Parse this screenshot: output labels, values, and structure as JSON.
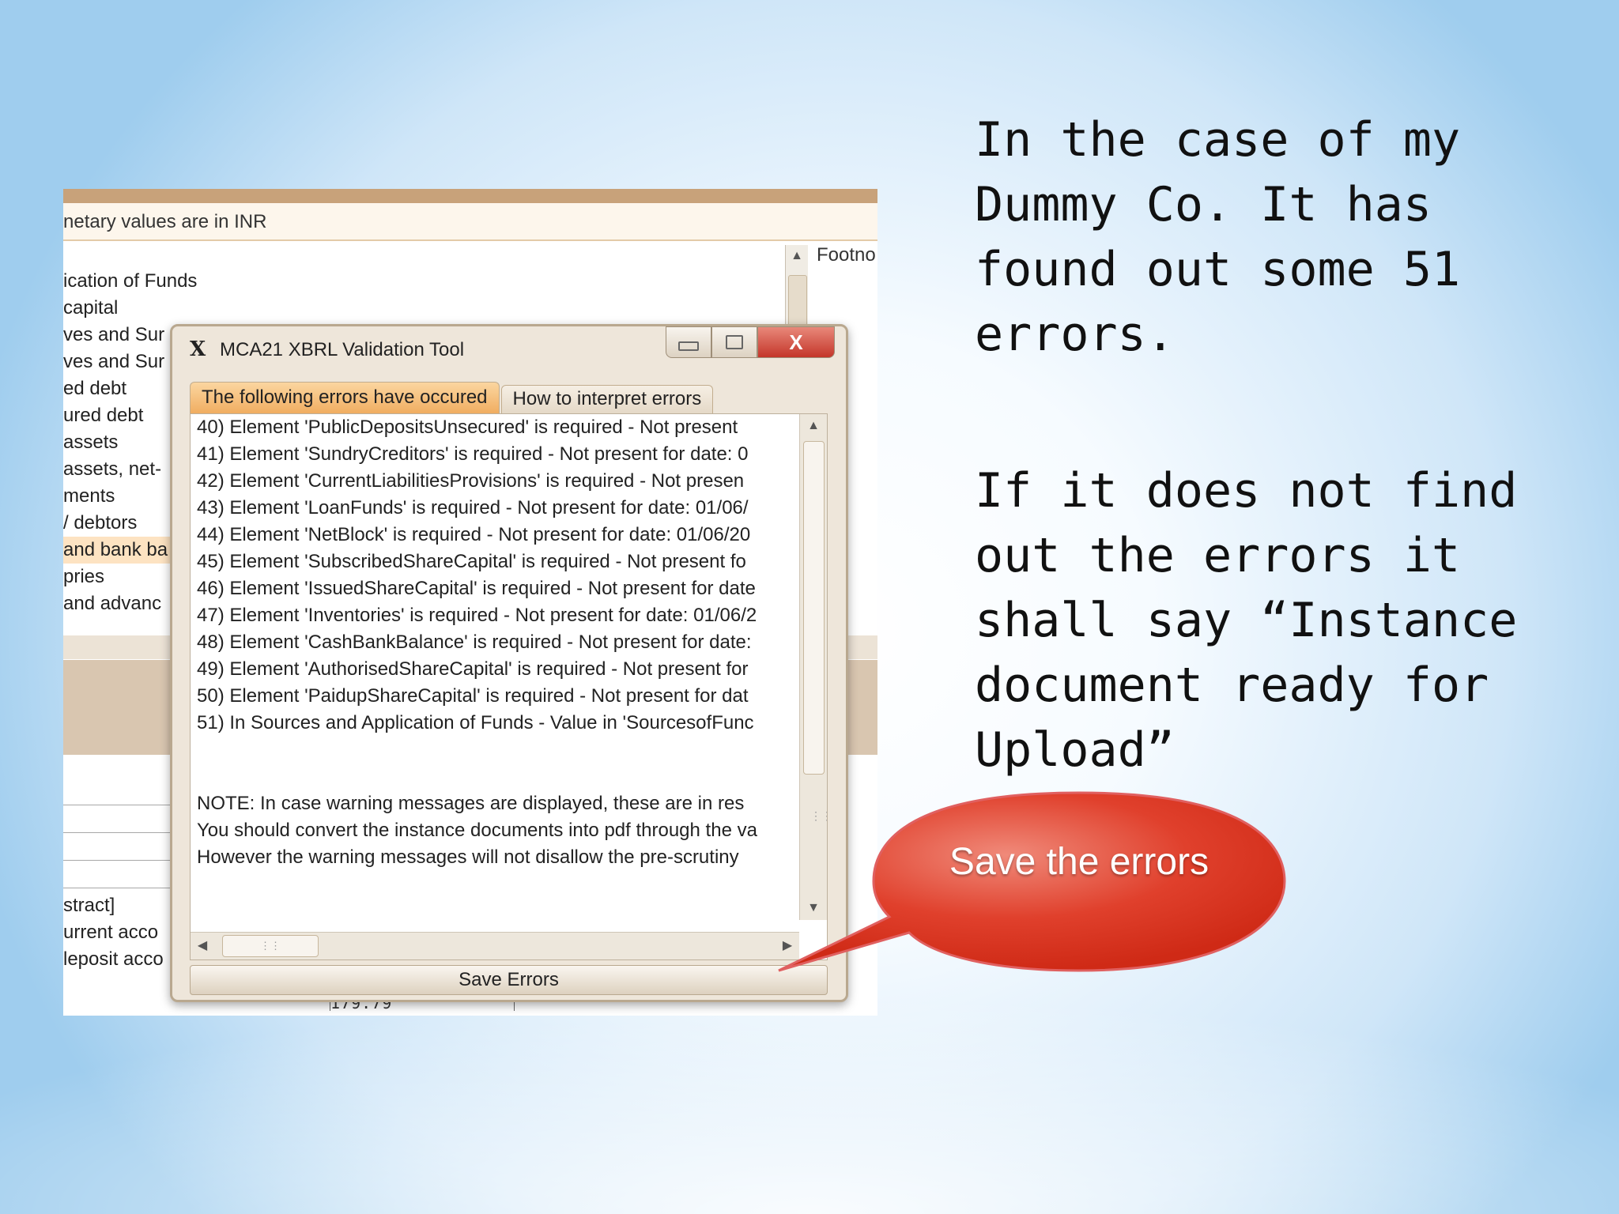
{
  "background_window": {
    "info_text": "netary values are in INR",
    "list_items": [
      "ication of Funds",
      " capital",
      "ves and Sur",
      "ves and Sur",
      "ed debt",
      "ured debt",
      "assets",
      "assets, net-",
      "ments",
      "/ debtors",
      "and bank ba",
      "pries",
      " and advanc"
    ],
    "footer_items": [
      "stract]",
      "urrent acco",
      "leposit acco"
    ],
    "footnote_label": "Footno",
    "number_value": "179.79"
  },
  "dialog": {
    "title": "MCA21 XBRL Validation Tool",
    "app_icon_glyph": "X",
    "close_glyph": "X",
    "tabs": [
      {
        "label": "The following errors have occured"
      },
      {
        "label": "How to interpret errors"
      }
    ],
    "errors": [
      "40) Element 'PublicDepositsUnsecured' is required - Not present",
      "41) Element 'SundryCreditors' is required - Not present for date: 0",
      "42) Element 'CurrentLiabilitiesProvisions' is required - Not presen",
      "43) Element 'LoanFunds' is required - Not present for date: 01/06/",
      "44) Element 'NetBlock' is required - Not present for date: 01/06/20",
      "45) Element 'SubscribedShareCapital' is required - Not present fo",
      "46) Element 'IssuedShareCapital' is required - Not present for date",
      "47) Element 'Inventories' is required - Not present for date: 01/06/2",
      "48) Element 'CashBankBalance' is required - Not present for date:",
      "49) Element 'AuthorisedShareCapital' is required - Not present for",
      "50) Element 'PaidupShareCapital' is required - Not present for dat",
      "51) In Sources and Application of Funds - Value in 'SourcesofFunc"
    ],
    "notes": [
      "NOTE: In case warning messages are displayed, these are in res",
      "You should convert the instance documents into pdf through the va",
      "However the warning messages will not disallow the pre-scrutiny"
    ],
    "save_button": "Save Errors"
  },
  "callout": {
    "text": "Save the errors",
    "color_light": "#f08a7a",
    "color_dark": "#cf2a16"
  },
  "slide": {
    "paragraph1": "In the case of my Dummy Co. It has found out some 51 errors.",
    "paragraph2": "If it does not find out the errors it shall say “Instance document ready for Upload”"
  }
}
